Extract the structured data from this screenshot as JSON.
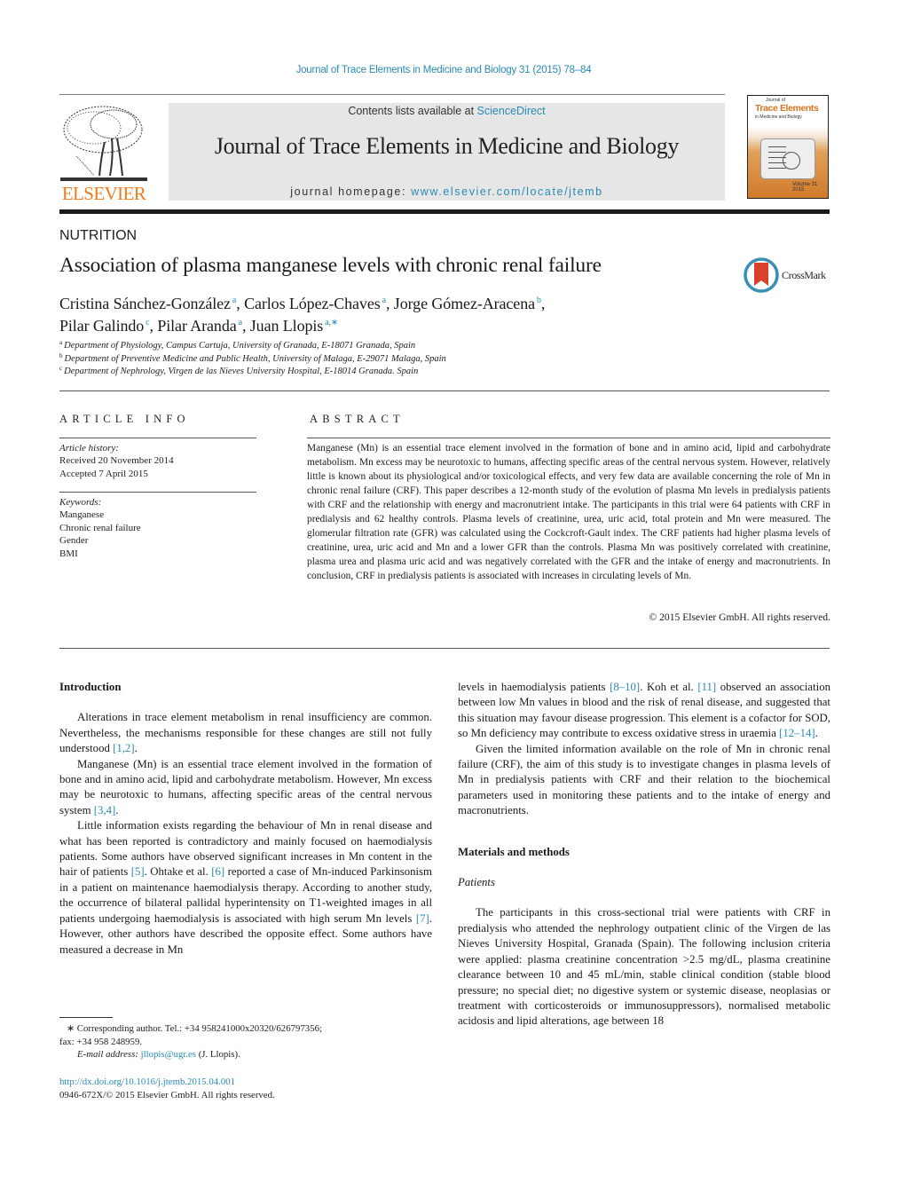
{
  "running_head": "Journal of Trace Elements in Medicine and Biology 31 (2015) 78–84",
  "publisher": {
    "name": "ELSEVIER",
    "logo_icon": "elsevier-tree-logo",
    "brand_color": "#f07b1c"
  },
  "banner": {
    "contents_prefix": "Contents lists available at ",
    "contents_link": "ScienceDirect",
    "journal_title": "Journal of Trace Elements in Medicine and Biology",
    "homepage_prefix": "journal homepage: ",
    "homepage_link": "www.elsevier.com/locate/jtemb"
  },
  "cover": {
    "title": "Trace Elements",
    "small": "Journal of",
    "subtitle": "in Medicine and Biology",
    "foot": "Volume 31 · 2015"
  },
  "section": "NUTRITION",
  "title": "Association of plasma manganese levels with chronic renal failure",
  "crossmark": {
    "label": "CrossMark",
    "icon": "crossmark-icon"
  },
  "authors": [
    {
      "name": "Cristina Sánchez-González",
      "sup": "a",
      "sep": ", "
    },
    {
      "name": "Carlos López-Chaves",
      "sup": "a",
      "sep": ", "
    },
    {
      "name": "Jorge Gómez-Aracena",
      "sup": "b",
      "sep": ","
    },
    {
      "name": "Pilar Galindo",
      "sup": "c",
      "sep": ", "
    },
    {
      "name": "Pilar Aranda",
      "sup": "a",
      "sep": ", "
    },
    {
      "name": "Juan Llopis",
      "sup": "a,∗",
      "sep": ""
    }
  ],
  "affiliations": [
    {
      "key": "a",
      "text": "Department of Physiology, Campus Cartuja, University of Granada, E-18071 Granada, Spain"
    },
    {
      "key": "b",
      "text": "Department of Preventive Medicine and Public Health, University of Malaga, E-29071 Malaga, Spain"
    },
    {
      "key": "c",
      "text": "Department of Nephrology, Virgen de las Nieves University Hospital, E-18014 Granada. Spain"
    }
  ],
  "article_info": {
    "heading": "ARTICLE INFO",
    "history_label": "Article history:",
    "received": "Received 20 November 2014",
    "accepted": "Accepted 7 April 2015",
    "keywords_label": "Keywords:",
    "keywords": [
      "Manganese",
      "Chronic renal failure",
      "Gender",
      "BMI"
    ]
  },
  "abstract": {
    "heading": "ABSTRACT",
    "text": "Manganese (Mn) is an essential trace element involved in the formation of bone and in amino acid, lipid and carbohydrate metabolism. Mn excess may be neurotoxic to humans, affecting specific areas of the central nervous system. However, relatively little is known about its physiological and/or toxicological effects, and very few data are available concerning the role of Mn in chronic renal failure (CRF). This paper describes a 12-month study of the evolution of plasma Mn levels in predialysis patients with CRF and the relationship with energy and macronutrient intake. The participants in this trial were 64 patients with CRF in predialysis and 62 healthy controls. Plasma levels of creatinine, urea, uric acid, total protein and Mn were measured. The glomerular filtration rate (GFR) was calculated using the Cockcroft-Gault index. The CRF patients had higher plasma levels of creatinine, urea, uric acid and Mn and a lower GFR than the controls. Plasma Mn was positively correlated with creatinine, plasma urea and plasma uric acid and was negatively correlated with the GFR and the intake of energy and macronutrients. In conclusion, CRF in predialysis patients is associated with increases in circulating levels of Mn.",
    "copyright": "© 2015 Elsevier GmbH. All rights reserved."
  },
  "body_left": {
    "heading": "Introduction",
    "paragraphs": [
      [
        {
          "t": "Alterations in trace element metabolism in renal insufficiency are common. Nevertheless, the mechanisms responsible for these changes are still not fully understood "
        },
        {
          "ref": "[1,2]"
        },
        {
          "t": "."
        }
      ],
      [
        {
          "t": "Manganese (Mn) is an essential trace element involved in the formation of bone and in amino acid, lipid and carbohydrate metabolism. However, Mn excess may be neurotoxic to humans, affecting specific areas of the central nervous system "
        },
        {
          "ref": "[3,4]"
        },
        {
          "t": "."
        }
      ],
      [
        {
          "t": "Little information exists regarding the behaviour of Mn in renal disease and what has been reported is contradictory and mainly focused on haemodialysis patients. Some authors have observed significant increases in Mn content in the hair of patients "
        },
        {
          "ref": "[5]"
        },
        {
          "t": ". Ohtake et al. "
        },
        {
          "ref": "[6]"
        },
        {
          "t": " reported a case of Mn-induced Parkinsonism in a patient on maintenance haemodialysis therapy. According to another study, the occurrence of bilateral pallidal hyperintensity on T1-weighted images in all patients undergoing haemodialysis is associated with high serum Mn levels "
        },
        {
          "ref": "[7]"
        },
        {
          "t": ". However, other authors have described the opposite effect. Some authors have measured a decrease in Mn"
        }
      ]
    ]
  },
  "body_right": {
    "continuation": [
      {
        "t": "levels in haemodialysis patients "
      },
      {
        "ref": "[8–10]"
      },
      {
        "t": ". Koh et al. "
      },
      {
        "ref": "[11]"
      },
      {
        "t": " observed an association between low Mn values in blood and the risk of renal disease, and suggested that this situation may favour disease progression. This element is a cofactor for SOD, so Mn deficiency may contribute to excess oxidative stress in uraemia "
      },
      {
        "ref": "[12–14]"
      },
      {
        "t": "."
      }
    ],
    "aim_paragraph": "Given the limited information available on the role of Mn in chronic renal failure (CRF), the aim of this study is to investigate changes in plasma levels of Mn in predialysis patients with CRF and their relation to the biochemical parameters used in monitoring these patients and to the intake of energy and macronutrients.",
    "methods_heading": "Materials and methods",
    "patients_heading": "Patients",
    "patients_paragraph": "The participants in this cross-sectional trial were patients with CRF in predialysis who attended the nephrology outpatient clinic of the Virgen de las Nieves University Hospital, Granada (Spain). The following inclusion criteria were applied: plasma creatinine concentration >2.5 mg/dL, plasma creatinine clearance between 10 and 45 mL/min, stable clinical condition (stable blood pressure; no special diet; no digestive system or systemic disease, neoplasias or treatment with corticosteroids or immunosuppressors), normalised metabolic acidosis and lipid alterations, age between 18"
  },
  "footnote": {
    "line1": "∗ Corresponding author. Tel.: +34 958241000x20320/626797356;",
    "line2": "fax: +34 958 248959.",
    "email_label": "E-mail address: ",
    "email": "jllopis@ugr.es",
    "email_suffix": " (J. Llopis)."
  },
  "doi": "http://dx.doi.org/10.1016/j.jtemb.2015.04.001",
  "issn_line": "0946-672X/© 2015 Elsevier GmbH. All rights reserved.",
  "colors": {
    "link": "#2a8ab5",
    "banner_bg": "#e6e6e6",
    "elsevier_orange": "#f07b1c"
  }
}
